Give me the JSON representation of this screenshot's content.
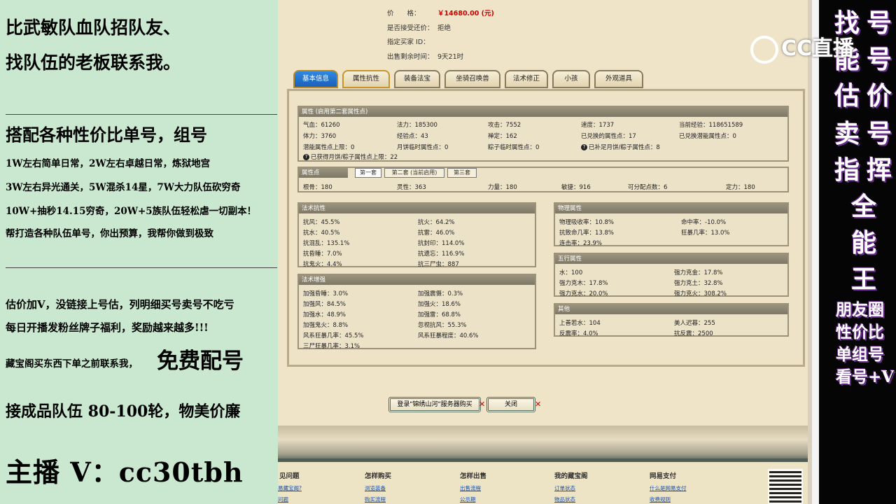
{
  "left": {
    "line1": "比武敏队血队招队友、",
    "line2": "找队伍的老板联系我。",
    "line3": "搭配各种性价比单号，组号",
    "line4": "1W左右简单日常，2W左右卓越日常，炼狱地宫",
    "line5": "3W左右异光通关，5W混杀14星，7W大力队伍砍穷奇",
    "line6": "10W+抽秒14.15穷奇，20W+5族队伍轻松虐一切副本！",
    "line7": "帮打造各种队伍单号，你出预算，我帮你做到极致",
    "line8": "估价加V，没链接上号估，列明细买号卖号不吃亏",
    "line9": "每日开播发粉丝牌子福利，奖励越来越多!!!",
    "line10": "藏宝阁买东西下单之前联系我，",
    "line10b": "免费配号",
    "line11": "接成品队伍 80-100轮，物美价廉",
    "line12": "主播 V：cc30tbh"
  },
  "info": {
    "price_label": "价　　格：",
    "price_value": "￥14680.00 (元)",
    "bargain_label": "是否接受还价：",
    "bargain_value": "拒绝",
    "buyer_label": "指定买家 ID：",
    "buyer_value": "",
    "time_label": "出售剩余时间：",
    "time_value": "9天21时"
  },
  "tabs": [
    "基本信息",
    "属性抗性",
    "装备法宝",
    "坐骑召唤兽",
    "法术修正",
    "小孩",
    "外观道具"
  ],
  "attr": {
    "header": "属性 (启用第二套属性点)",
    "r1": [
      "气血：61260",
      "法力：185300",
      "攻击：7552",
      "速度：1737",
      "当前经验：118651589"
    ],
    "r2": [
      "体力：3760",
      "经验点：43",
      "禅定：162",
      "已兑换的属性点：17",
      "已兑换潜能属性点：0"
    ],
    "r3": [
      "潜能属性点上限：0",
      "月饼临时属性点：0",
      "粽子临时属性点：0",
      "已补足月饼/粽子属性点：8"
    ],
    "r4": "已获得月饼/粽子属性点上限：22"
  },
  "points": {
    "header": "属性点",
    "subtabs": [
      "第一套",
      "第二套 (当前启用)",
      "第三套"
    ],
    "row": [
      "根骨：180",
      "灵性：363",
      "力量：180",
      "敏捷：916",
      "可分配点数：6",
      "定力：180"
    ]
  },
  "resist": {
    "header": "法术抗性",
    "rows": [
      [
        "抗风：45.5%",
        "抗火：64.2%"
      ],
      [
        "抗水：40.5%",
        "抗雷：46.0%"
      ],
      [
        "抗混乱：135.1%",
        "抗封印：114.0%"
      ],
      [
        "抗昏睡：7.0%",
        "抗遗忘：116.9%"
      ],
      [
        "抗鬼火：4.4%",
        "抗三尸虫：887"
      ]
    ]
  },
  "enhance": {
    "header": "法术增强",
    "rows": [
      [
        "加强昏睡：3.0%",
        "加强震慑：0.3%"
      ],
      [
        "加强风：84.5%",
        "加强火：18.6%"
      ],
      [
        "加强水：48.9%",
        "加强雷：68.8%"
      ],
      [
        "加强鬼火：8.8%",
        "忽视抗风：55.3%"
      ],
      [
        "风系狂暴几率：45.5%",
        "风系狂暴程度：40.6%"
      ],
      [
        "三尸狂暴几率：3.1%",
        ""
      ]
    ]
  },
  "physical": {
    "header": "物理属性",
    "rows": [
      [
        "物理吸收率：10.8%",
        "命中率：-10.0%"
      ],
      [
        "抗致命几率：13.8%",
        "狂暴几率：13.0%"
      ],
      [
        "连击率：23.9%",
        ""
      ]
    ]
  },
  "five": {
    "header": "五行属性",
    "rows": [
      [
        "水：100",
        "强力克金：17.8%"
      ],
      [
        "强力克木：17.8%",
        "强力克土：32.8%"
      ],
      [
        "强力克水：20.0%",
        "强力克火：308.2%"
      ]
    ]
  },
  "other": {
    "header": "其他",
    "rows": [
      [
        "上善若水：104",
        "美人迟暮：255"
      ],
      [
        "反震率：4.0%",
        "抗反震：2500"
      ]
    ]
  },
  "buttons": {
    "login": "登录\"锦绣山河\"服务器购买",
    "close": "关闭",
    "x": "✕"
  },
  "footer": {
    "cols": [
      "见问题",
      "怎样购买",
      "怎样出售",
      "我的藏宝阁",
      "网易支付"
    ],
    "links": [
      [
        "易藏宝阁?",
        "问题"
      ],
      [
        "浏览装备",
        "购买流程"
      ],
      [
        "出售流程",
        "公示期"
      ],
      [
        "订单状态",
        "物品状态"
      ],
      [
        "什么是网易支付",
        "收费规则"
      ]
    ]
  },
  "logo": "CC直播",
  "right": {
    "col1": [
      "找",
      "能",
      "估",
      "卖",
      "指",
      "全",
      "能",
      "王"
    ],
    "col2": [
      "号",
      "号",
      "价",
      "号",
      "挥"
    ],
    "small": [
      "朋友圈",
      "性价比",
      "单组号",
      "看号+V"
    ]
  }
}
